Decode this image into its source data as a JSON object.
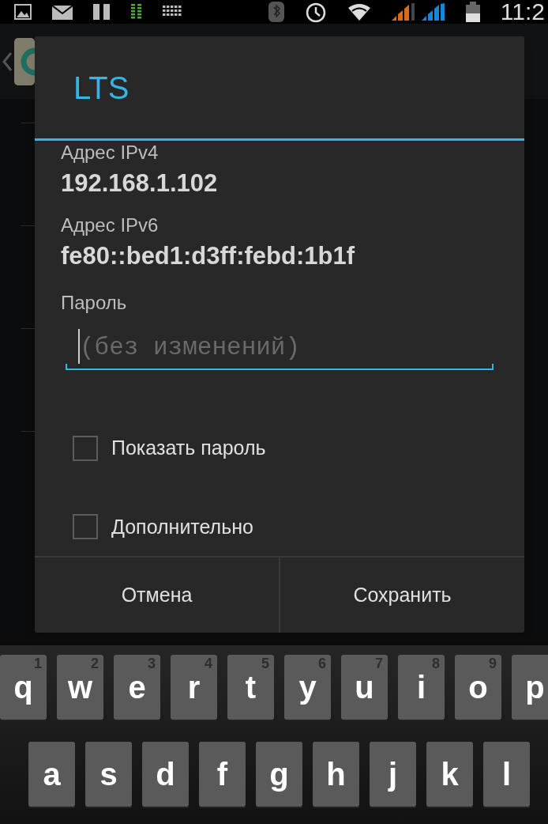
{
  "status_bar": {
    "time": "11:2"
  },
  "dialog": {
    "title": "LTS",
    "fields": [
      {
        "label": "Адрес IPv4",
        "value": "192.168.1.102"
      },
      {
        "label": "Адрес IPv6",
        "value": "fe80::bed1:d3ff:febd:1b1f"
      }
    ],
    "password": {
      "label": "Пароль",
      "placeholder": "(без изменений)"
    },
    "checkboxes": [
      {
        "label": "Показать пароль",
        "checked": false
      },
      {
        "label": "Дополнительно",
        "checked": false
      }
    ],
    "buttons": [
      "Отмена",
      "Сохранить"
    ]
  },
  "keyboard": {
    "rows": [
      [
        {
          "key": "q",
          "hint": "1"
        },
        {
          "key": "w",
          "hint": "2"
        },
        {
          "key": "e",
          "hint": "3"
        },
        {
          "key": "r",
          "hint": "4"
        },
        {
          "key": "t",
          "hint": "5"
        },
        {
          "key": "y",
          "hint": "6"
        },
        {
          "key": "u",
          "hint": "7"
        },
        {
          "key": "i",
          "hint": "8"
        },
        {
          "key": "o",
          "hint": "9"
        },
        {
          "key": "p"
        }
      ],
      [
        {
          "key": "a"
        },
        {
          "key": "s"
        },
        {
          "key": "d"
        },
        {
          "key": "f"
        },
        {
          "key": "g"
        },
        {
          "key": "h"
        },
        {
          "key": "j"
        },
        {
          "key": "k"
        },
        {
          "key": "l"
        }
      ]
    ]
  }
}
